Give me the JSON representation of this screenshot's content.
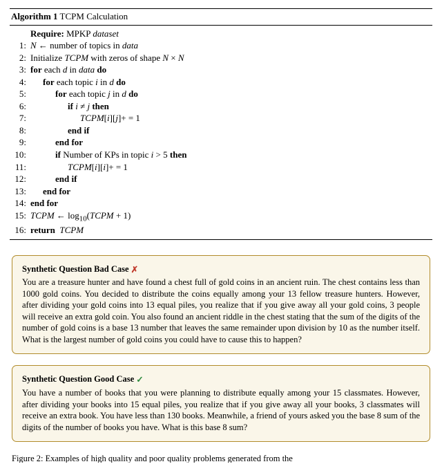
{
  "algorithm": {
    "number": "1",
    "title": "TCPM Calculation",
    "require_kw": "Require:",
    "require_text": "MPKP dataset",
    "lines": [
      {
        "n": "1:",
        "indent": 0,
        "html": "<i class='var'>N</i> ← number of topics in <i class='var'>data</i>"
      },
      {
        "n": "2:",
        "indent": 0,
        "html": "Initialize <i class='var'>TCPM</i> with zeros of shape <i class='var'>N</i> × <i class='var'>N</i>"
      },
      {
        "n": "3:",
        "indent": 0,
        "html": "<b class='kw'>for</b> each <i class='var'>d</i> in <i class='var'>data</i> <b class='kw'>do</b>"
      },
      {
        "n": "4:",
        "indent": 1,
        "html": "<b class='kw'>for</b> each topic <i class='var'>i</i> in <i class='var'>d</i> <b class='kw'>do</b>"
      },
      {
        "n": "5:",
        "indent": 2,
        "html": "<b class='kw'>for</b> each topic <i class='var'>j</i> in <i class='var'>d</i> <b class='kw'>do</b>"
      },
      {
        "n": "6:",
        "indent": 3,
        "html": "<b class='kw'>if</b> <i class='var'>i</i> ≠ <i class='var'>j</i> <b class='kw'>then</b>"
      },
      {
        "n": "7:",
        "indent": 4,
        "html": "<i class='var'>TCPM</i>[<i class='var'>i</i>][<i class='var'>j</i>]+ = 1"
      },
      {
        "n": "8:",
        "indent": 3,
        "html": "<b class='kw'>end if</b>"
      },
      {
        "n": "9:",
        "indent": 2,
        "html": "<b class='kw'>end for</b>"
      },
      {
        "n": "10:",
        "indent": 2,
        "html": "<b class='kw'>if</b> Number of KPs in topic <i class='var'>i</i> &gt; 5 <b class='kw'>then</b>"
      },
      {
        "n": "11:",
        "indent": 3,
        "html": "<i class='var'>TCPM</i>[<i class='var'>i</i>][<i class='var'>i</i>]+ = 1"
      },
      {
        "n": "12:",
        "indent": 2,
        "html": "<b class='kw'>end if</b>"
      },
      {
        "n": "13:",
        "indent": 1,
        "html": "<b class='kw'>end for</b>"
      },
      {
        "n": "14:",
        "indent": 0,
        "html": "<b class='kw'>end for</b>"
      },
      {
        "n": "15:",
        "indent": 0,
        "html": "<i class='var'>TCPM</i> ← log<sub>10</sub>(<i class='var'>TCPM</i> + 1)"
      },
      {
        "n": "16:",
        "indent": 0,
        "html": "<b class='kw'>return</b>  <i class='var'>TCPM</i>"
      }
    ]
  },
  "bad": {
    "title": "Synthetic Question Bad Case",
    "mark": "✗",
    "mark_color": "#c0392b",
    "body": "You are a treasure hunter and have found a chest full of gold coins in an ancient ruin. The chest contains less than 1000 gold coins. You decided to distribute the coins equally among your 13 fellow treasure hunters. However, after dividing your gold coins into 13 equal piles, you realize that if you give away all your gold coins, 3 people will receive an extra gold coin. You also found an ancient riddle in the chest stating that the sum of the digits of the number of gold coins is a base 13 number that leaves the same remainder upon division by 10 as the number itself. What is the largest number of gold coins you could have to cause this to happen?"
  },
  "good": {
    "title": "Synthetic Question Good Case",
    "mark": "✓",
    "mark_color": "#2e8b3d",
    "body": "You have a number of books that you were planning to distribute equally among your 15 classmates. However, after dividing your books into 15 equal piles, you realize that if you give away all your books, 3 classmates will receive an extra book. You have less than 130 books. Meanwhile, a friend of yours asked you the base 8 sum of the digits of the number of books you have. What is this base 8 sum?"
  },
  "caption": "Figure 2: Examples of high quality and poor quality problems generated from the"
}
